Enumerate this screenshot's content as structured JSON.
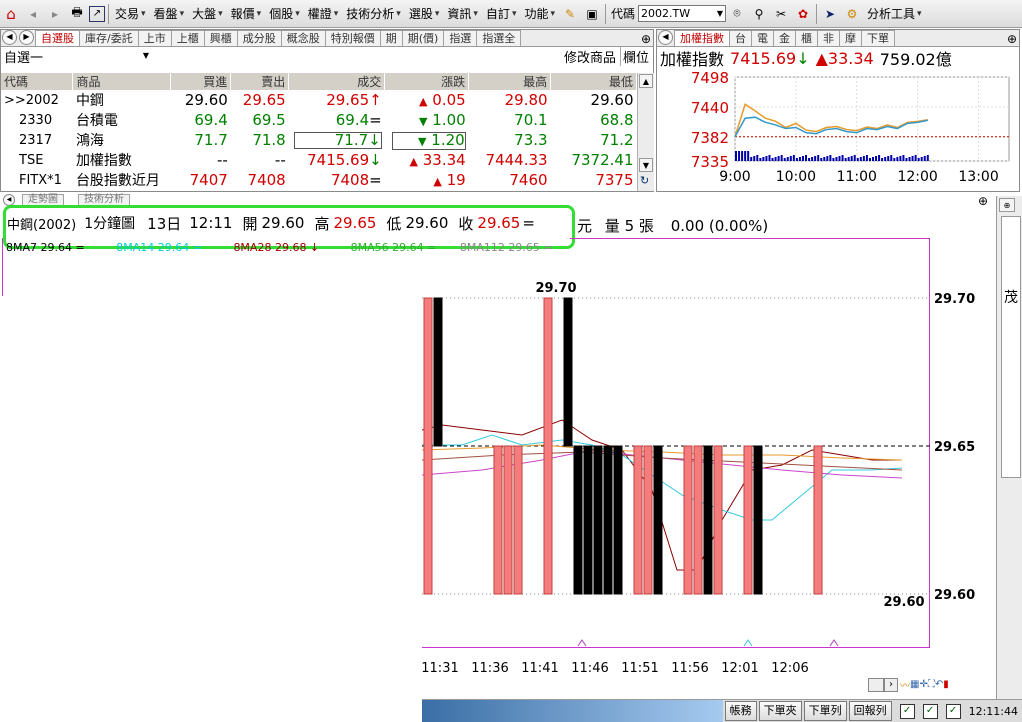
{
  "toolbar": {
    "menus": [
      "交易",
      "看盤",
      "大盤",
      "報價",
      "個股",
      "權證",
      "技術分析",
      "選股",
      "資訊",
      "自訂",
      "功能"
    ],
    "code_label": "代碼",
    "code_value": "2002.TW",
    "analysis_tools": "分析工具"
  },
  "quote_panel": {
    "tabs": [
      "自選股",
      "庫存/委託",
      "上市",
      "上櫃",
      "興櫃",
      "成分股",
      "概念股",
      "特別報價",
      "期",
      "期(價)",
      "指選",
      "指選全"
    ],
    "list_name": "自選一",
    "edit_label": "修改商品",
    "column_label": "欄位",
    "headers": [
      "代碼",
      "商品",
      "買進",
      "賣出",
      "成交",
      "漲跌",
      "最高",
      "最低"
    ],
    "rows": [
      {
        "code": ">>2002",
        "name": "中鋼",
        "bid": "29.60",
        "ask": "29.65",
        "last": "29.65",
        "last_mark": "↑",
        "chg": "0.05",
        "chg_dir": "▲",
        "high": "29.80",
        "low": "29.60"
      },
      {
        "code": "2330",
        "name": "台積電",
        "bid": "69.4",
        "ask": "69.5",
        "last": "69.4",
        "last_mark": "=",
        "chg": "1.00",
        "chg_dir": "▼",
        "high": "70.1",
        "low": "68.8"
      },
      {
        "code": "2317",
        "name": "鴻海",
        "bid": "71.7",
        "ask": "71.8",
        "last": "71.7",
        "last_mark": "↓",
        "chg": "1.20",
        "chg_dir": "▼",
        "high": "73.3",
        "low": "71.2"
      },
      {
        "code": "TSE",
        "name": "加權指數",
        "bid": "--",
        "ask": "--",
        "last": "7415.69",
        "last_mark": "↓",
        "chg": "33.34",
        "chg_dir": "▲",
        "high": "7444.33",
        "low": "7372.41"
      },
      {
        "code": "FITX*1",
        "name": "台股指數近月",
        "bid": "7407",
        "ask": "7408",
        "last": "7408",
        "last_mark": "=",
        "chg": "19",
        "chg_dir": "▲",
        "high": "7460",
        "low": "7375"
      }
    ]
  },
  "index_panel": {
    "tabs": [
      "加權指數",
      "台",
      "電",
      "金",
      "櫃",
      "非",
      "摩",
      "下單"
    ],
    "name": "加權指數",
    "value": "7415.69",
    "value_mark": "↓",
    "change": "33.34",
    "change_mark": "▲",
    "volume": "759.02億"
  },
  "sub_tabs": [
    "走勢圖",
    "技術分析"
  ],
  "info_bar": {
    "stock": "中鋼(2002)",
    "period": "1分鐘圖",
    "date": "13日",
    "time": "12:11",
    "open_label": "開",
    "open": "29.60",
    "high_label": "高",
    "high": "29.65",
    "low_label": "低",
    "low": "29.60",
    "close_label": "收",
    "close": "29.65",
    "close_mark": "=",
    "unit": "元",
    "vol_label": "量",
    "vol": "5",
    "vol_unit": "張",
    "change": "0.00 (0.00%)"
  },
  "ma_row": [
    "8MA7 29.64 =",
    "8MA14 29.64 =",
    "8MA28 29.68 ↓",
    "8MA56 29.64 =",
    "8MA112 29.65 ="
  ],
  "right_sidebar_text": "茂",
  "status_bar": {
    "buttons": [
      "帳務",
      "下單夾",
      "下單列",
      "回報列"
    ],
    "clock": "12:11:44"
  },
  "chart_data": [
    {
      "type": "line",
      "title": "加權指數",
      "x_ticks": [
        "9:00",
        "10:00",
        "11:00",
        "12:00",
        "13:00"
      ],
      "y_ticks": [
        7498,
        7440,
        7382,
        7335
      ],
      "reference": 7382,
      "series": [
        {
          "x": [
            "9:00",
            "9:10",
            "9:20",
            "9:30",
            "9:40",
            "9:50",
            "10:00",
            "10:10",
            "10:20",
            "10:30",
            "10:40",
            "10:50",
            "11:00",
            "11:10",
            "11:20",
            "11:30",
            "11:40",
            "11:50",
            "12:00",
            "12:10"
          ],
          "values": [
            7382,
            7445,
            7432,
            7418,
            7412,
            7400,
            7408,
            7395,
            7392,
            7400,
            7402,
            7396,
            7394,
            7401,
            7398,
            7405,
            7400,
            7410,
            7412,
            7415
          ]
        },
        {
          "x": [
            "9:00",
            "9:10",
            "9:20",
            "9:30",
            "9:40",
            "9:50",
            "10:00",
            "10:10",
            "10:20",
            "10:30",
            "10:40",
            "10:50",
            "11:00",
            "11:10",
            "11:20",
            "11:30",
            "11:40",
            "11:50",
            "12:00",
            "12:10"
          ],
          "values": [
            7382,
            7418,
            7420,
            7410,
            7405,
            7398,
            7400,
            7390,
            7388,
            7396,
            7398,
            7392,
            7390,
            7398,
            7396,
            7402,
            7398,
            7408,
            7410,
            7414
          ]
        }
      ]
    },
    {
      "type": "bar",
      "title": "中鋼(2002) 1分鐘圖",
      "x_ticks": [
        "11:31",
        "11:36",
        "11:41",
        "11:46",
        "11:51",
        "11:56",
        "12:01",
        "12:06"
      ],
      "y_ticks": [
        29.7,
        29.65,
        29.6
      ],
      "annotations": [
        "29.70",
        "29.60"
      ],
      "candles": [
        {
          "t": "11:31",
          "open": 29.7,
          "close": 29.6,
          "up": true
        },
        {
          "t": "11:32",
          "open": 29.7,
          "close": 29.65,
          "up": false
        },
        {
          "t": "11:38",
          "open": 29.65,
          "close": 29.6,
          "up": true
        },
        {
          "t": "11:39",
          "open": 29.65,
          "close": 29.6,
          "up": true
        },
        {
          "t": "11:40",
          "open": 29.65,
          "close": 29.6,
          "up": true
        },
        {
          "t": "11:43",
          "open": 29.7,
          "close": 29.6,
          "up": true
        },
        {
          "t": "11:45",
          "open": 29.7,
          "close": 29.65,
          "up": false
        },
        {
          "t": "11:46",
          "open": 29.65,
          "close": 29.6,
          "up": false
        },
        {
          "t": "11:47",
          "open": 29.65,
          "close": 29.6,
          "up": false
        },
        {
          "t": "11:48",
          "open": 29.65,
          "close": 29.6,
          "up": false
        },
        {
          "t": "11:49",
          "open": 29.65,
          "close": 29.6,
          "up": false
        },
        {
          "t": "11:50",
          "open": 29.65,
          "close": 29.6,
          "up": false
        },
        {
          "t": "11:52",
          "open": 29.65,
          "close": 29.6,
          "up": true
        },
        {
          "t": "11:53",
          "open": 29.65,
          "close": 29.6,
          "up": true
        },
        {
          "t": "11:54",
          "open": 29.65,
          "close": 29.6,
          "up": false
        },
        {
          "t": "11:57",
          "open": 29.65,
          "close": 29.6,
          "up": true
        },
        {
          "t": "11:58",
          "open": 29.65,
          "close": 29.6,
          "up": true
        },
        {
          "t": "11:59",
          "open": 29.65,
          "close": 29.6,
          "up": false
        },
        {
          "t": "12:00",
          "open": 29.65,
          "close": 29.6,
          "up": true
        },
        {
          "t": "12:03",
          "open": 29.65,
          "close": 29.6,
          "up": true
        },
        {
          "t": "12:04",
          "open": 29.65,
          "close": 29.6,
          "up": false
        },
        {
          "t": "12:10",
          "open": 29.65,
          "close": 29.6,
          "up": true
        }
      ]
    }
  ],
  "colors": {
    "up": "#f47c7c",
    "down": "#000000",
    "red_text": "#d00000",
    "green_text": "#008000",
    "highlight": "#33dd33",
    "chart_border": "#cc33cc"
  }
}
